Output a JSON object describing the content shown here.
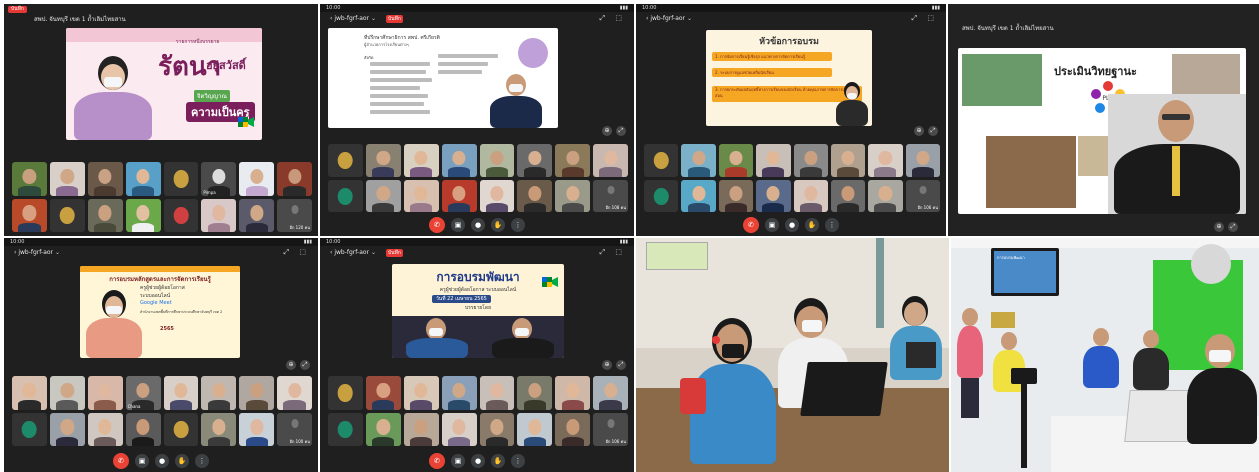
{
  "panels": {
    "p1": {
      "rec_label": "บันทึก",
      "meet_code": "สพป. จันทบุรี เขต 1 ถ้ำเลิม่ไทยสาน",
      "slide": {
        "title_main": "รัตนา",
        "title_sub": "อยู่สวัสดิ์",
        "title_small": "รายการหนึ่งบรรยาย",
        "badge": "ความเป็นครู",
        "badge_prefix": "จิตวิญญาณ"
      },
      "tile_labels": {
        "t13": "Pimpa",
        "t24": "อีก 120 คน"
      }
    },
    "p2": {
      "status_time": "10:00",
      "meet_code": "jwb-fgrf-aor",
      "rec_label": "บันทึก",
      "slide": {
        "heading": "ที่ปรึกษาศึกษาธิการ สพป. ศรีเกียรติ",
        "subheading": "ผู้อำนวยการโรงเรียนต่างๆ",
        "section": "สังกัด"
      },
      "tile_labels": {
        "t24": "อีก 108 คน"
      }
    },
    "p3": {
      "status_time": "10:00",
      "meet_code": "jwb-fgrf-aor",
      "slide": {
        "title": "หัวข้อการอบรม",
        "items": [
          "1. การจัดการเรียนรู้เชิงรุก แนวทางการจัดการเรียนรู้",
          "2. ระบบการดูแลช่วยเหลือนักเรียน",
          "3. การยกระดับผลสัมฤทธิ์ทางการเรียนของนักเรียน ด้วยคุณภาพการจัดการเรียนการสอน"
        ]
      },
      "tile_labels": {
        "t24": "อีก 106 คน"
      }
    },
    "p4": {
      "meet_code": "สพป. จันทบุรี เขต 1 ถ้ำเลิม่ไทยสาน",
      "slide": {
        "title": "ประเมินวิทยฐานะ",
        "logo_text": "PLC"
      }
    },
    "p5": {
      "status_time": "10:00",
      "meet_code": "jwb-fgrf-aor",
      "slide": {
        "title": "การอบรมหลักสูตรและการจัดการเรียนรู้",
        "line1": "ครูผู้ช่วยผู้ด้อยโอกาส",
        "line2": "ระบบออนไลน์",
        "line3": "Google Meet",
        "line4": "สำนักงานเขตพื้นที่การศึกษาประถมศึกษาจันทบุรี เขต 2",
        "year": "2565"
      },
      "tile_labels": {
        "t10": "Chana",
        "t13": "อีก 100 คน"
      }
    },
    "p6": {
      "status_time": "10:00",
      "meet_code": "jwb-fgrf-aor",
      "rec_label": "บันทึก",
      "slide": {
        "title": "การอบรมพัฒนา",
        "sub1": "ครูผู้ช่วยผู้ด้อยโอกาส ระบบออนไลน์",
        "sub2": "วันที่ 22 เมษายน 2565",
        "sub3": "บรรยายโดย"
      },
      "tile_labels": {
        "t24": "อีก 106 คน"
      }
    },
    "p8": {
      "monitor_text": "การอบรมพัฒนา"
    }
  },
  "icons": {
    "end_call": "phone-hangup-icon",
    "mic": "mic-icon",
    "camera": "camera-icon",
    "hand": "raise-hand-icon",
    "more": "more-vert-icon"
  },
  "colors": {
    "meet_dark": "#1f1f1f",
    "end_red": "#ea4335",
    "slide_orange": "#f5a623"
  }
}
